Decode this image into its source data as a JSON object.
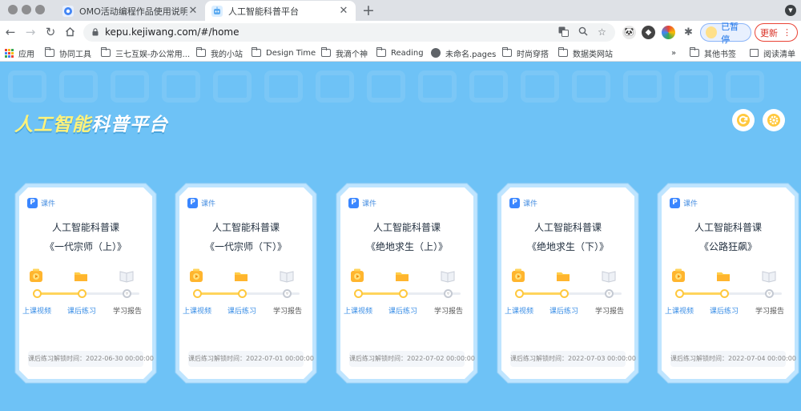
{
  "browser": {
    "tabs": [
      {
        "title": "OMO活动编程作品使用说明 · 语",
        "active": false
      },
      {
        "title": "人工智能科普平台",
        "active": true
      }
    ],
    "url": "kepu.kejiwang.com/#/home",
    "paused_label": "已暂停",
    "update_label": "更新",
    "bookmarks": [
      "应用",
      "协同工具",
      "三七互娱-办公常用...",
      "我的小站",
      "Design Time",
      "我滴个神",
      "Reading",
      "未命名.pages",
      "时尚穿搭",
      "数据类网站"
    ],
    "bookmarks_more": "»",
    "other_bookmarks": "其他书签",
    "reading_list": "阅读清单"
  },
  "page": {
    "brand_part1": "人工智能",
    "brand_part2": "科普平台",
    "cards": [
      {
        "tag": "课件",
        "title": "人工智能科普课",
        "subtitle": "《一代宗师（上）》",
        "steps": [
          "上课视频",
          "课后练习",
          "学习报告"
        ],
        "unlock": "课后练习解锁时间：2022-06-30 00:00:00"
      },
      {
        "tag": "课件",
        "title": "人工智能科普课",
        "subtitle": "《一代宗师（下）》",
        "steps": [
          "上课视频",
          "课后练习",
          "学习报告"
        ],
        "unlock": "课后练习解锁时间：2022-07-01 00:00:00"
      },
      {
        "tag": "课件",
        "title": "人工智能科普课",
        "subtitle": "《绝地求生（上）》",
        "steps": [
          "上课视频",
          "课后练习",
          "学习报告"
        ],
        "unlock": "课后练习解锁时间：2022-07-02 00:00:00"
      },
      {
        "tag": "课件",
        "title": "人工智能科普课",
        "subtitle": "《绝地求生（下）》",
        "steps": [
          "上课视频",
          "课后练习",
          "学习报告"
        ],
        "unlock": "课后练习解锁时间：2022-07-03 00:00:00"
      },
      {
        "tag": "课件",
        "title": "人工智能科普课",
        "subtitle": "《公路狂飙》",
        "steps": [
          "上课视频",
          "课后练习",
          "学习报告"
        ],
        "unlock": "课后练习解锁时间：2022-07-04 00:00:00"
      }
    ],
    "colors": {
      "accent_yellow": "#ffc83d",
      "step_active": "#3a8ee6",
      "background": "#6ec2f6"
    }
  }
}
